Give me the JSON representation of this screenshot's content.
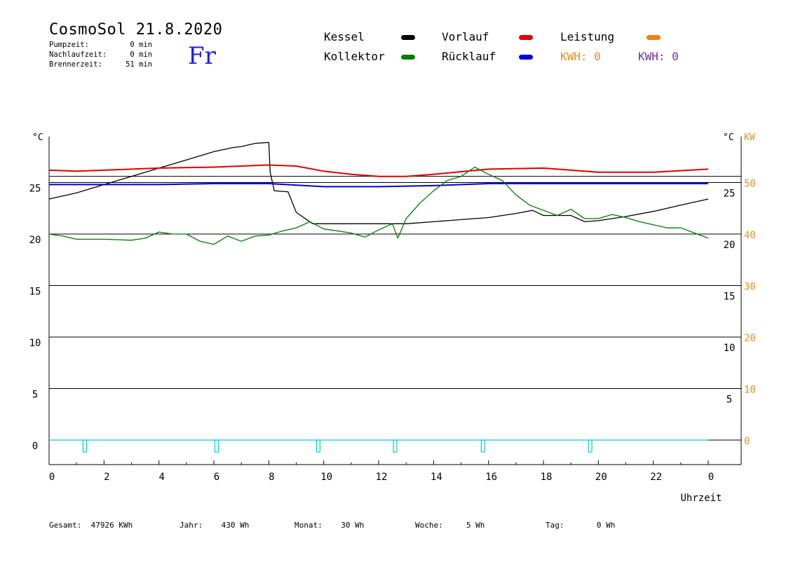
{
  "header": {
    "title": "CosmoSol 21.8.2020",
    "day": "Fr",
    "stats": [
      {
        "label": "Pumpzeit:",
        "value": "0 min"
      },
      {
        "label": "Nachlaufzeit:",
        "value": "0 min"
      },
      {
        "label": "Brennerzeit:",
        "value": "51 min"
      }
    ]
  },
  "legend": {
    "items": [
      {
        "label": "Kessel",
        "color": "#000000"
      },
      {
        "label": "Vorlauf",
        "color": "#e00000"
      },
      {
        "label": "Leistung",
        "color": "#f08010"
      },
      {
        "label": "Kollektor",
        "color": "#007a00"
      },
      {
        "label": "Rücklauf",
        "color": "#0000e0"
      }
    ],
    "kwh": [
      {
        "text": "KWH: 0",
        "color": "#e09020"
      },
      {
        "text": "KWH: 0",
        "color": "#7030a0"
      }
    ]
  },
  "footer": [
    {
      "label": "Gesamt:",
      "value": "47926 KWh"
    },
    {
      "label": "Jahr:",
      "value": "430 Wh"
    },
    {
      "label": "Monat:",
      "value": "30 Wh"
    },
    {
      "label": "Woche:",
      "value": "5 Wh"
    },
    {
      "label": "Tag:",
      "value": "0 Wh"
    }
  ],
  "chart_data": {
    "type": "line",
    "xlabel": "Uhrzeit",
    "x_ticks": [
      "0",
      "2",
      "4",
      "6",
      "8",
      "10",
      "12",
      "14",
      "16",
      "18",
      "20",
      "22",
      "0"
    ],
    "xlim": [
      0,
      24
    ],
    "y_left": {
      "unit": "°C",
      "ticks": [
        "25",
        "20",
        "15",
        "10",
        "5",
        "0"
      ],
      "ylim": [
        0,
        25
      ]
    },
    "y_right_temp": {
      "unit": "°C",
      "ticks": [
        "25",
        "20",
        "15",
        "10",
        "5"
      ]
    },
    "y_right_power": {
      "unit": "KW",
      "ticks": [
        "50",
        "40",
        "30",
        "20",
        "10",
        "0"
      ],
      "ylim": [
        0,
        50
      ]
    },
    "grid": true,
    "series": [
      {
        "name": "Kessel",
        "color": "#000000",
        "points": [
          [
            0,
            23.4
          ],
          [
            1,
            24
          ],
          [
            2,
            24.8
          ],
          [
            3,
            25.6
          ],
          [
            4,
            26.4
          ],
          [
            5,
            27.2
          ],
          [
            6,
            28
          ],
          [
            6.7,
            28.4
          ],
          [
            7,
            28.5
          ],
          [
            7.5,
            28.8
          ],
          [
            8.0,
            28.9
          ],
          [
            8.05,
            26
          ],
          [
            8.2,
            24.2
          ],
          [
            8.7,
            24.1
          ],
          [
            9.0,
            22.1
          ],
          [
            9.6,
            21
          ],
          [
            10,
            21
          ],
          [
            11,
            21
          ],
          [
            12,
            21
          ],
          [
            13,
            21
          ],
          [
            14,
            21.2
          ],
          [
            15,
            21.4
          ],
          [
            16,
            21.6
          ],
          [
            17,
            22
          ],
          [
            17.6,
            22.3
          ],
          [
            18,
            21.8
          ],
          [
            19,
            21.8
          ],
          [
            19.5,
            21.2
          ],
          [
            20,
            21.3
          ],
          [
            21,
            21.7
          ],
          [
            22,
            22.2
          ],
          [
            23,
            22.8
          ],
          [
            24,
            23.4
          ]
        ]
      },
      {
        "name": "Vorlauf",
        "color": "#e00000",
        "points": [
          [
            0,
            26.2
          ],
          [
            1,
            26.1
          ],
          [
            2,
            26.2
          ],
          [
            4,
            26.4
          ],
          [
            6,
            26.5
          ],
          [
            8,
            26.7
          ],
          [
            9,
            26.6
          ],
          [
            10,
            26.1
          ],
          [
            11,
            25.8
          ],
          [
            12,
            25.6
          ],
          [
            13,
            25.6
          ],
          [
            14,
            25.8
          ],
          [
            16,
            26.3
          ],
          [
            18,
            26.4
          ],
          [
            20,
            26.0
          ],
          [
            22,
            26.0
          ],
          [
            24,
            26.3
          ]
        ]
      },
      {
        "name": "Rücklauf",
        "color": "#0000e0",
        "points": [
          [
            0,
            24.8
          ],
          [
            2,
            24.8
          ],
          [
            4,
            24.8
          ],
          [
            6,
            24.9
          ],
          [
            8,
            24.9
          ],
          [
            10,
            24.6
          ],
          [
            12,
            24.6
          ],
          [
            14,
            24.7
          ],
          [
            16,
            24.9
          ],
          [
            18,
            24.9
          ],
          [
            20,
            24.9
          ],
          [
            22,
            24.9
          ],
          [
            24,
            24.9
          ]
        ]
      },
      {
        "name": "Kollektor",
        "color": "#007a00",
        "points": [
          [
            0,
            20.0
          ],
          [
            0.5,
            19.8
          ],
          [
            1,
            19.5
          ],
          [
            2,
            19.5
          ],
          [
            3,
            19.4
          ],
          [
            3.5,
            19.6
          ],
          [
            4,
            20.2
          ],
          [
            4.5,
            20.0
          ],
          [
            5,
            20.0
          ],
          [
            5.5,
            19.3
          ],
          [
            6,
            19.0
          ],
          [
            6.5,
            19.8
          ],
          [
            7,
            19.3
          ],
          [
            7.5,
            19.8
          ],
          [
            8,
            19.9
          ],
          [
            8.5,
            20.3
          ],
          [
            9,
            20.6
          ],
          [
            9.5,
            21.2
          ],
          [
            10,
            20.5
          ],
          [
            11,
            20.1
          ],
          [
            11.5,
            19.7
          ],
          [
            12,
            20.4
          ],
          [
            12.5,
            21.0
          ],
          [
            12.7,
            19.6
          ],
          [
            13,
            21.5
          ],
          [
            13.5,
            23.0
          ],
          [
            14,
            24.2
          ],
          [
            14.5,
            25.2
          ],
          [
            15,
            25.6
          ],
          [
            15.5,
            26.5
          ],
          [
            16,
            25.8
          ],
          [
            16.5,
            25.2
          ],
          [
            17,
            23.8
          ],
          [
            17.5,
            22.8
          ],
          [
            18,
            22.3
          ],
          [
            18.5,
            21.8
          ],
          [
            19,
            22.4
          ],
          [
            19.5,
            21.5
          ],
          [
            20,
            21.5
          ],
          [
            20.5,
            21.9
          ],
          [
            21,
            21.6
          ],
          [
            21.5,
            21.2
          ],
          [
            22,
            20.9
          ],
          [
            22.5,
            20.6
          ],
          [
            23,
            20.6
          ],
          [
            23.5,
            20.1
          ],
          [
            24,
            19.6
          ]
        ]
      },
      {
        "name": "Leistung",
        "color": "#00d0d0",
        "pulses_hours": [
          1.3,
          6.1,
          9.8,
          12.6,
          15.8,
          19.7
        ]
      }
    ]
  }
}
